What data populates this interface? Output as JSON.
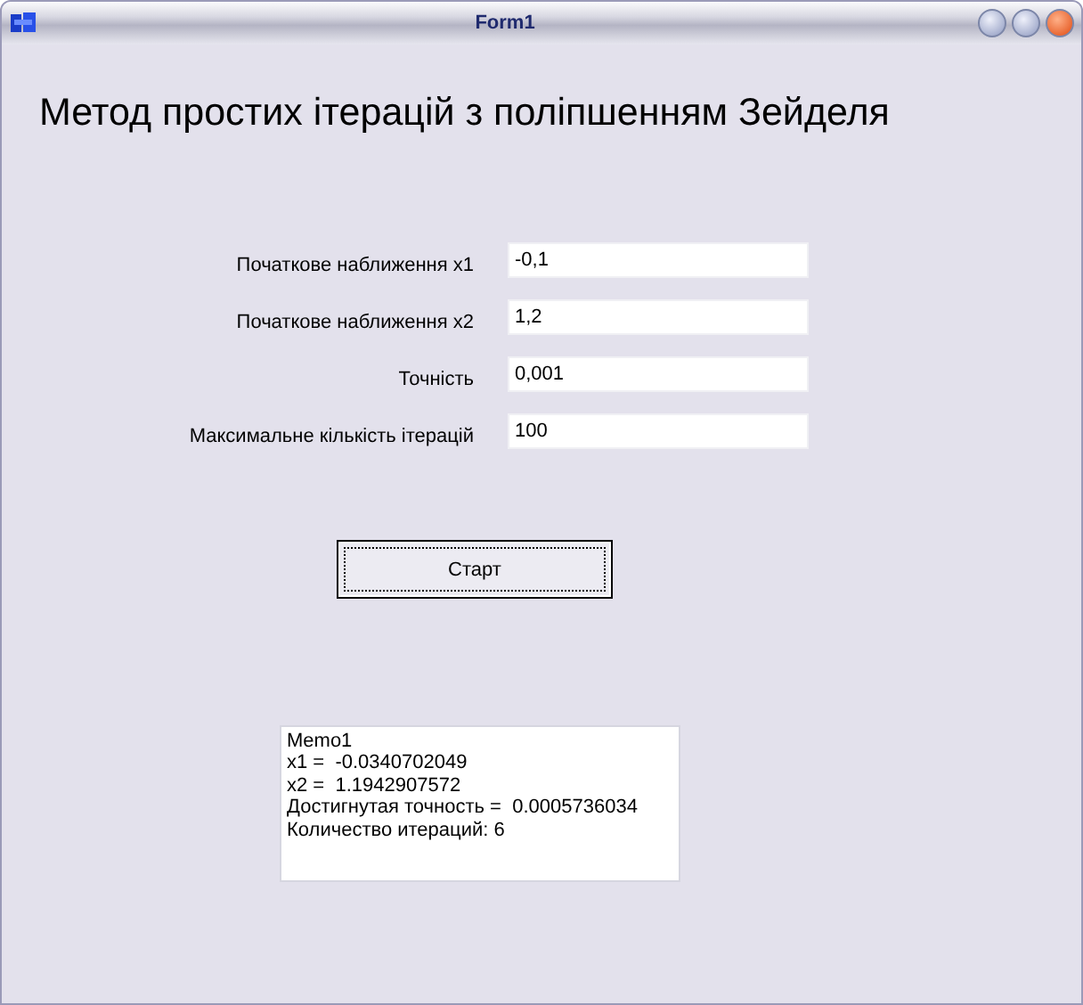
{
  "window": {
    "title": "Form1"
  },
  "heading": "Метод простих ітерацій з поліпшенням Зейделя",
  "fields": [
    {
      "label": "Початкове наближення x1",
      "value": "-0,1"
    },
    {
      "label": "Початкове наближення x2",
      "value": "1,2"
    },
    {
      "label": "Точність",
      "value": "0,001"
    },
    {
      "label": "Максимальне кількість ітерацій",
      "value": "100"
    }
  ],
  "start_button": {
    "label": "Старт",
    "focused": true
  },
  "memo": {
    "lines": [
      "Memo1",
      "x1 =  -0.0340702049",
      "x2 =  1.1942907572",
      "Достигнутая точность =  0.0005736034",
      "Количество итераций: 6"
    ]
  }
}
